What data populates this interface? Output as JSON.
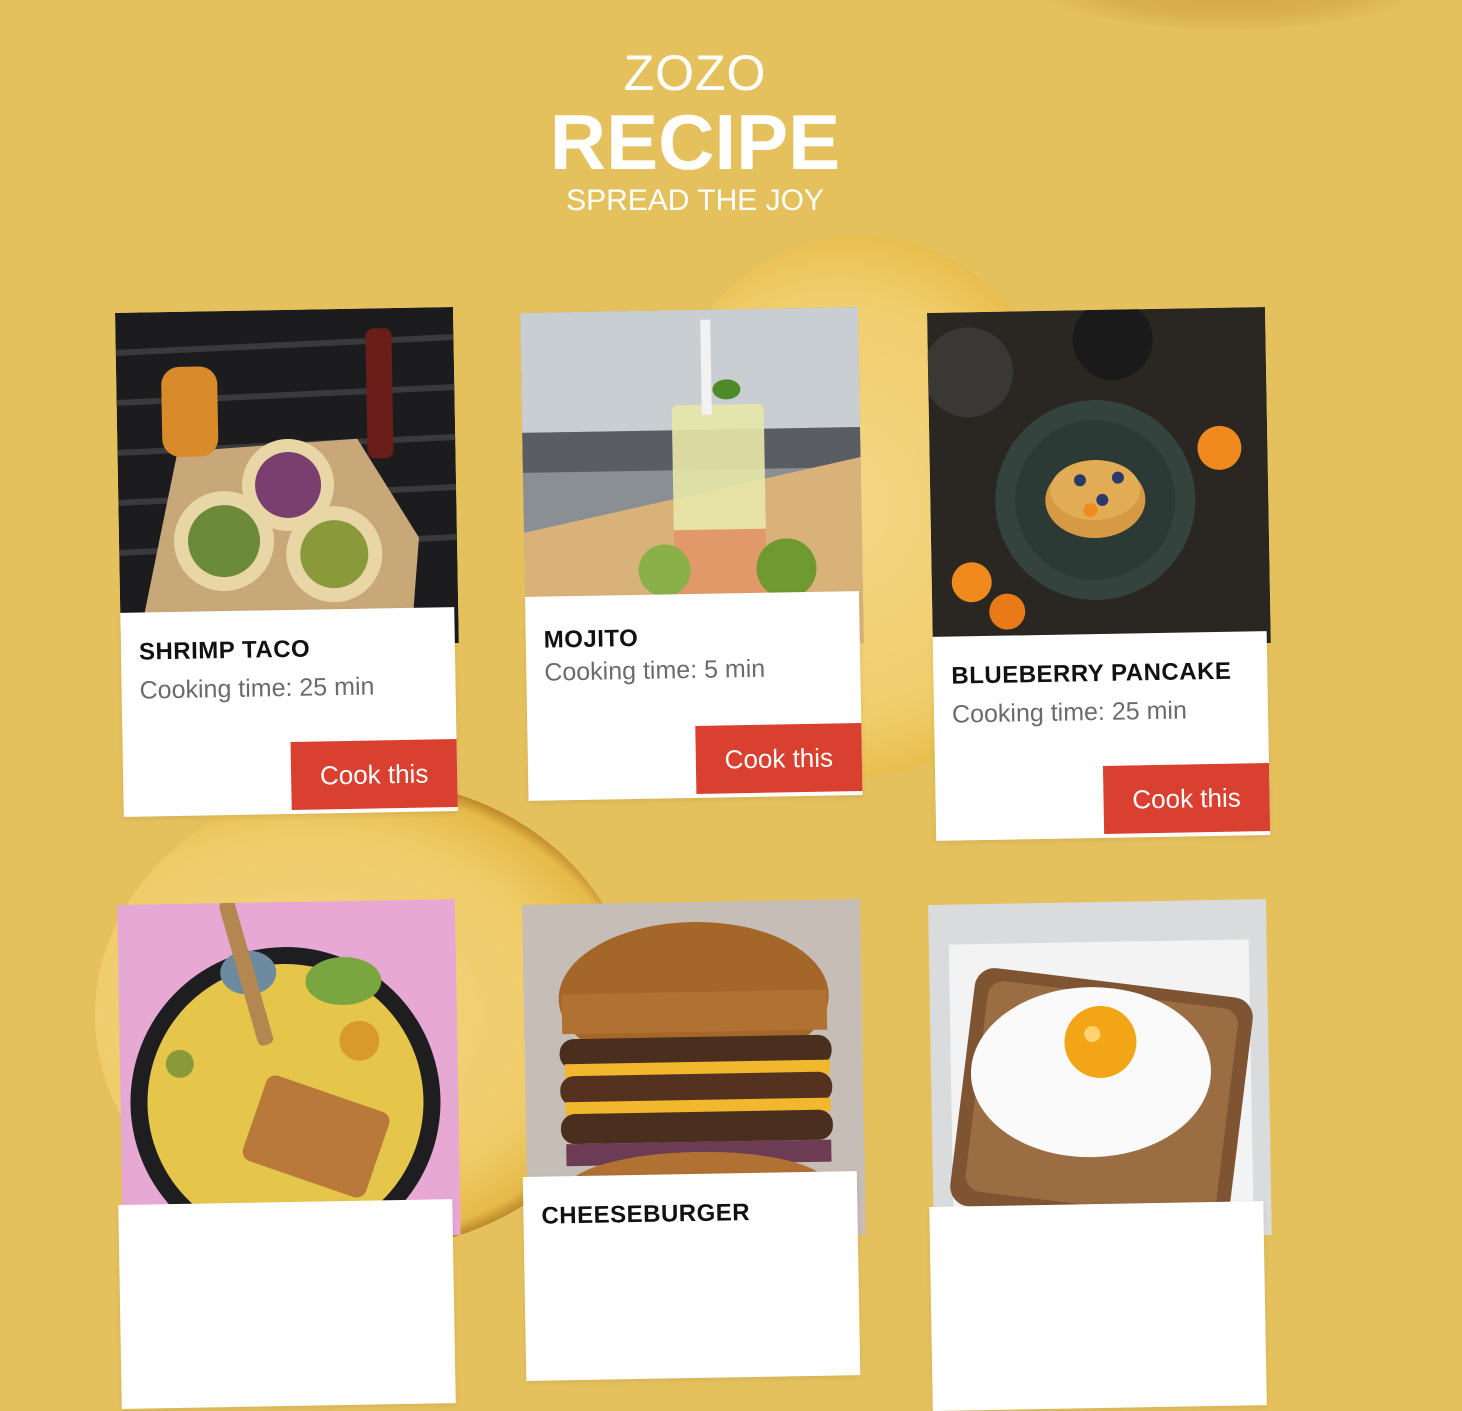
{
  "header": {
    "brand": "ZOZO",
    "title": "RECIPE",
    "tagline": "SPREAD THE JOY"
  },
  "recipes": [
    {
      "name": "SHRIMP TACO",
      "time": "Cooking time: 25 min",
      "button": "Cook this",
      "photo": "shrimp-taco-photo"
    },
    {
      "name": "MOJITO",
      "time": "Cooking time: 5 min",
      "button": "Cook this",
      "photo": "mojito-photo"
    },
    {
      "name": "BLUEBERRY PANCAKE",
      "time": "Cooking time: 25 min",
      "button": "Cook this",
      "photo": "blueberry-pancake-photo"
    },
    {
      "name": "",
      "time": "",
      "button": "",
      "photo": "rice-bowl-photo"
    },
    {
      "name": "CHEESEBURGER",
      "time": "",
      "button": "",
      "photo": "cheeseburger-photo"
    },
    {
      "name": "",
      "time": "",
      "button": "",
      "photo": "egg-toast-photo"
    }
  ],
  "colors": {
    "background": "#e5c15e",
    "button": "#d9402f",
    "heading": "#ffffff"
  }
}
